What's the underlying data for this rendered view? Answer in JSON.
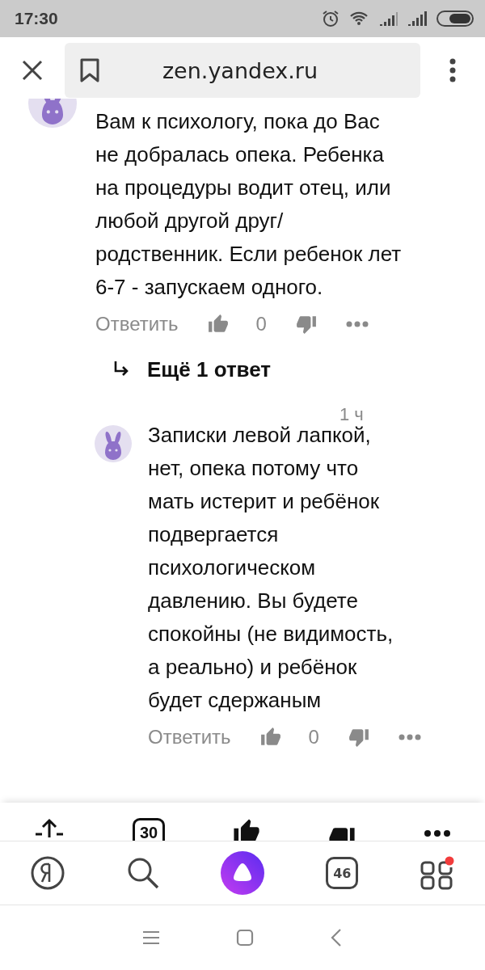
{
  "status_bar": {
    "time": "17:30"
  },
  "browser_bar": {
    "url": "zen.yandex.ru"
  },
  "thread": [
    {
      "kind": "comment",
      "text": "Вам к психологу, пока до Вас\nне добралась опека. Ребенка\nна процедуры водит отец, или\nлюбой другой друг/\nродственник. Если ребенок лет\n6-7 - запускаем одного.",
      "reply_label": "Ответить",
      "likes": "0"
    },
    {
      "kind": "more_replies",
      "label": "Ещё 1 ответ"
    },
    {
      "kind": "reply",
      "time": "1 ч",
      "text": "Записки левой лапкой,\nнет, опека потому что\nмать истерит и ребёнок\nподвергается\nпсихологическом\nдавлению. Вы будете\nспокойны (не видимость,\nа реально) и ребёнок\nбудет сдержаным",
      "reply_label": "Ответить",
      "likes": "0"
    }
  ],
  "article_toolbar": {
    "comments_count": "30"
  },
  "tab_bar": {
    "tabs_count": "46",
    "has_notification": true
  }
}
